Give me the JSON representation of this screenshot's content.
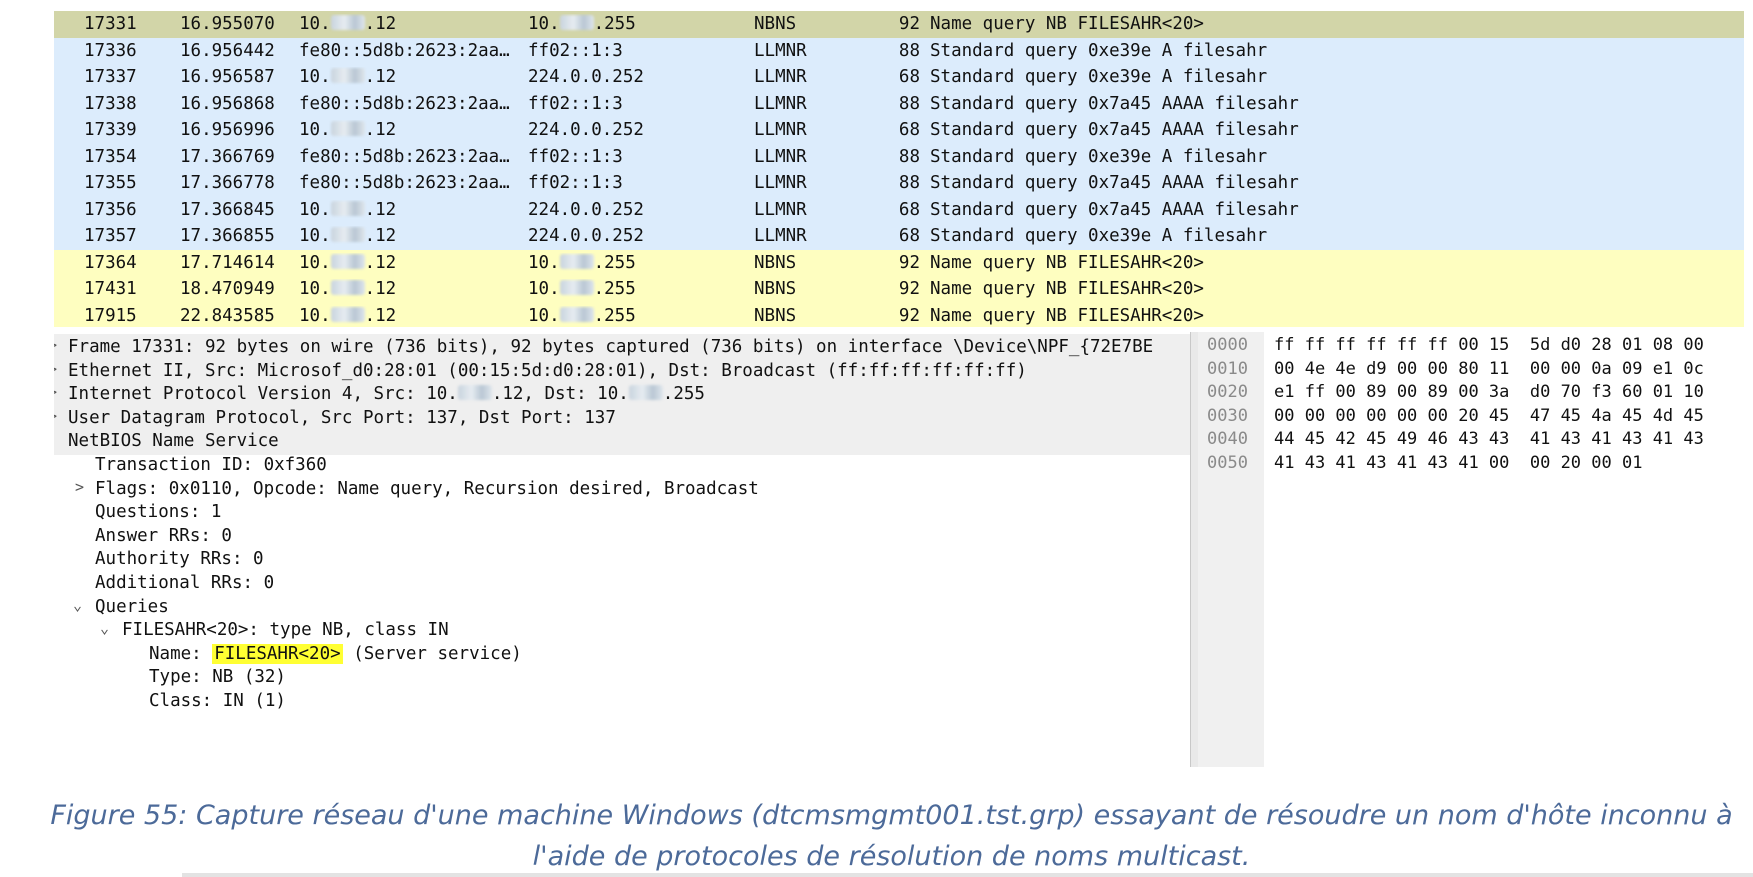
{
  "packets": [
    {
      "no": "17331",
      "time": "16.955070",
      "src_pre": "10.",
      "src_suf": ".12",
      "dst_pre": "10.",
      "dst_suf": ".255",
      "proto": "NBNS",
      "len": "92",
      "info": "Name query NB FILESAHR<20>",
      "color": "#d2d5a8"
    },
    {
      "no": "17336",
      "time": "16.956442",
      "src_pre": "fe80::5d8b:2623:2aa…",
      "src_suf": "",
      "dst_pre": "ff02::1:3",
      "dst_suf": "",
      "proto": "LLMNR",
      "len": "88",
      "info": "Standard query 0xe39e A filesahr",
      "color": "#dcecfc"
    },
    {
      "no": "17337",
      "time": "16.956587",
      "src_pre": "10.",
      "src_suf": ".12",
      "dst_pre": "224.0.0.252",
      "dst_suf": "",
      "proto": "LLMNR",
      "len": "68",
      "info": "Standard query 0xe39e A filesahr",
      "color": "#dcecfc"
    },
    {
      "no": "17338",
      "time": "16.956868",
      "src_pre": "fe80::5d8b:2623:2aa…",
      "src_suf": "",
      "dst_pre": "ff02::1:3",
      "dst_suf": "",
      "proto": "LLMNR",
      "len": "88",
      "info": "Standard query 0x7a45 AAAA filesahr",
      "color": "#dcecfc"
    },
    {
      "no": "17339",
      "time": "16.956996",
      "src_pre": "10.",
      "src_suf": ".12",
      "dst_pre": "224.0.0.252",
      "dst_suf": "",
      "proto": "LLMNR",
      "len": "68",
      "info": "Standard query 0x7a45 AAAA filesahr",
      "color": "#dcecfc"
    },
    {
      "no": "17354",
      "time": "17.366769",
      "src_pre": "fe80::5d8b:2623:2aa…",
      "src_suf": "",
      "dst_pre": "ff02::1:3",
      "dst_suf": "",
      "proto": "LLMNR",
      "len": "88",
      "info": "Standard query 0xe39e A filesahr",
      "color": "#dcecfc"
    },
    {
      "no": "17355",
      "time": "17.366778",
      "src_pre": "fe80::5d8b:2623:2aa…",
      "src_suf": "",
      "dst_pre": "ff02::1:3",
      "dst_suf": "",
      "proto": "LLMNR",
      "len": "88",
      "info": "Standard query 0x7a45 AAAA filesahr",
      "color": "#dcecfc"
    },
    {
      "no": "17356",
      "time": "17.366845",
      "src_pre": "10.",
      "src_suf": ".12",
      "dst_pre": "224.0.0.252",
      "dst_suf": "",
      "proto": "LLMNR",
      "len": "68",
      "info": "Standard query 0x7a45 AAAA filesahr",
      "color": "#dcecfc"
    },
    {
      "no": "17357",
      "time": "17.366855",
      "src_pre": "10.",
      "src_suf": ".12",
      "dst_pre": "224.0.0.252",
      "dst_suf": "",
      "proto": "LLMNR",
      "len": "68",
      "info": "Standard query 0xe39e A filesahr",
      "color": "#dcecfc"
    },
    {
      "no": "17364",
      "time": "17.714614",
      "src_pre": "10.",
      "src_suf": ".12",
      "dst_pre": "10.",
      "dst_suf": ".255",
      "proto": "NBNS",
      "len": "92",
      "info": "Name query NB FILESAHR<20>",
      "color": "#fefec0"
    },
    {
      "no": "17431",
      "time": "18.470949",
      "src_pre": "10.",
      "src_suf": ".12",
      "dst_pre": "10.",
      "dst_suf": ".255",
      "proto": "NBNS",
      "len": "92",
      "info": "Name query NB FILESAHR<20>",
      "color": "#fefec0"
    },
    {
      "no": "17915",
      "time": "22.843585",
      "src_pre": "10.",
      "src_suf": ".12",
      "dst_pre": "10.",
      "dst_suf": ".255",
      "proto": "NBNS",
      "len": "92",
      "info": "Name query NB FILESAHR<20>",
      "color": "#fefec0"
    }
  ],
  "details": {
    "frame": "Frame 17331: 92 bytes on wire (736 bits), 92 bytes captured (736 bits) on interface \\Device\\NPF_{72E7BE",
    "ethernet": "Ethernet II, Src: Microsof_d0:28:01 (00:15:5d:d0:28:01), Dst: Broadcast (ff:ff:ff:ff:ff:ff)",
    "ip_pre": "Internet Protocol Version 4, Src: 10.",
    "ip_mid": ".12, Dst: 10.",
    "ip_suf": ".255",
    "udp": "User Datagram Protocol, Src Port: 137, Dst Port: 137",
    "netbios": "NetBIOS Name Service",
    "transaction_id": "Transaction ID: 0xf360",
    "flags": "Flags: 0x0110, Opcode: Name query, Recursion desired, Broadcast",
    "questions": "Questions: 1",
    "answer_rrs": "Answer RRs: 0",
    "authority_rrs": "Authority RRs: 0",
    "additional_rrs": "Additional RRs: 0",
    "queries": "Queries",
    "query_item": "FILESAHR<20>: type NB, class IN",
    "name_label": "Name: ",
    "name_value": "FILESAHR<20>",
    "name_suffix": " (Server service)",
    "type": "Type: NB (32)",
    "class": "Class: IN (1)",
    "icons": {
      "collapsed": "chevron-right-icon",
      "expanded": "chevron-down-icon"
    },
    "highlight_color": "#ffff33"
  },
  "bytes": [
    {
      "offset": "0000",
      "hex": "ff ff ff ff ff ff 00 15  5d d0 28 01 08 00"
    },
    {
      "offset": "0010",
      "hex": "00 4e 4e d9 00 00 80 11  00 00 0a 09 e1 0c"
    },
    {
      "offset": "0020",
      "hex": "e1 ff 00 89 00 89 00 3a  d0 70 f3 60 01 10"
    },
    {
      "offset": "0030",
      "hex": "00 00 00 00 00 00 20 45  47 45 4a 45 4d 45"
    },
    {
      "offset": "0040",
      "hex": "44 45 42 45 49 46 43 43  41 43 41 43 41 43"
    },
    {
      "offset": "0050",
      "hex": "41 43 41 43 41 43 41 00  00 20 00 01"
    }
  ],
  "caption": {
    "line1": "Figure 55: Capture réseau d'une machine Windows (dtcmsmgmt001.tst.grp) essayant de résoudre un nom d'hôte inconnu à",
    "line2": "l'aide de protocoles de résolution de noms multicast."
  }
}
